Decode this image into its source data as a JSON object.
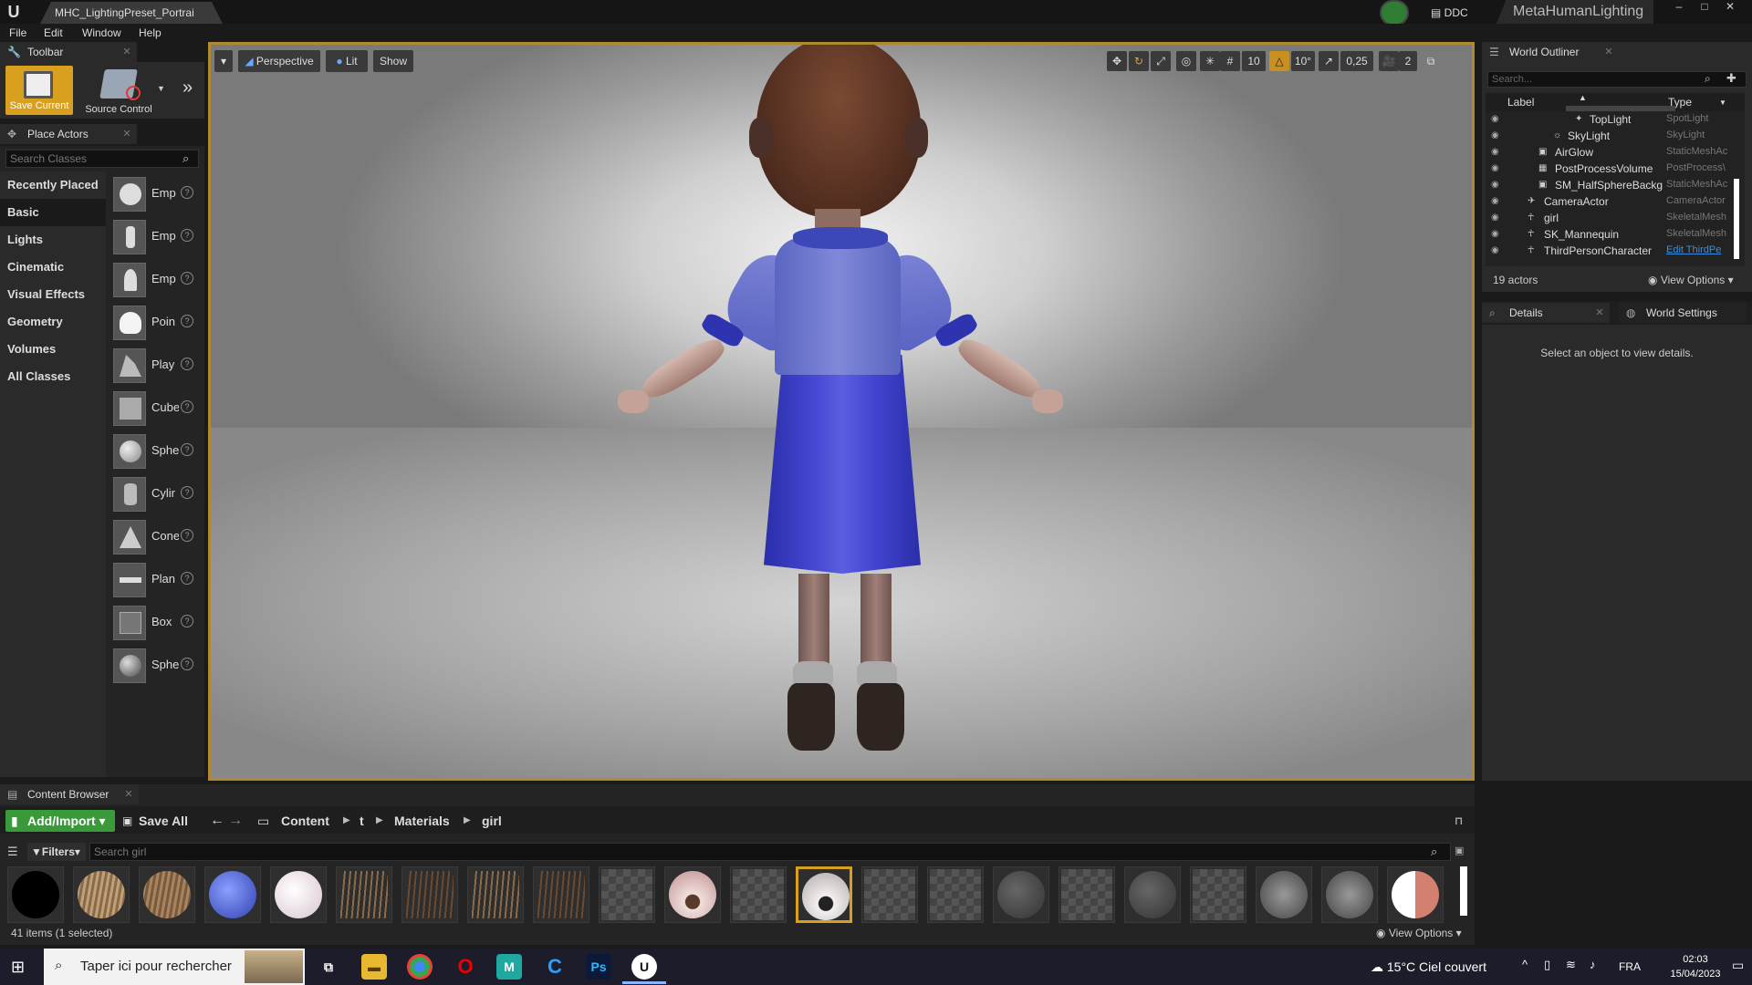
{
  "window": {
    "doc_tab": "MHC_LightingPreset_Portrai",
    "ddc": "DDC",
    "project": "MetaHumanLighting",
    "buttons": {
      "minimize": "–",
      "maximize": "□",
      "close": "✕"
    }
  },
  "menu": [
    "File",
    "Edit",
    "Window",
    "Help"
  ],
  "toolbar": {
    "tab": "Toolbar",
    "save_current": "Save Current",
    "source_control": "Source Control"
  },
  "place_actors": {
    "tab": "Place Actors",
    "search_placeholder": "Search Classes",
    "categories": [
      "Recently Placed",
      "Basic",
      "Lights",
      "Cinematic",
      "Visual Effects",
      "Geometry",
      "Volumes",
      "All Classes"
    ],
    "active_category": "Basic",
    "items": [
      {
        "label": "Emp",
        "icon": "empty-actor-icon"
      },
      {
        "label": "Emp",
        "icon": "empty-character-icon"
      },
      {
        "label": "Emp",
        "icon": "empty-pawn-icon"
      },
      {
        "label": "Poin",
        "icon": "point-light-icon"
      },
      {
        "label": "Play",
        "icon": "player-start-icon"
      },
      {
        "label": "Cube",
        "icon": "cube-icon"
      },
      {
        "label": "Sphe",
        "icon": "sphere-icon"
      },
      {
        "label": "Cylir",
        "icon": "cylinder-icon"
      },
      {
        "label": "Cone",
        "icon": "cone-icon"
      },
      {
        "label": "Plan",
        "icon": "plane-icon"
      },
      {
        "label": "Box",
        "icon": "box-trigger-icon"
      },
      {
        "label": "Sphe",
        "icon": "sphere-trigger-icon"
      }
    ]
  },
  "viewport": {
    "view_mode": "Perspective",
    "lighting": "Lit",
    "show": "Show",
    "grid_snap": "10",
    "rotation_snap": "10°",
    "scale_snap": "0,25",
    "camera_speed": "2"
  },
  "outliner": {
    "tab": "World Outliner",
    "search_placeholder": "Search...",
    "col_label": "Label",
    "col_type": "Type",
    "rows": [
      {
        "label": "TopLight",
        "type": "SpotLight",
        "indent": 3,
        "icon": "spotlight-icon"
      },
      {
        "label": "SkyLight",
        "type": "SkyLight",
        "indent": 2,
        "icon": "skylight-icon"
      },
      {
        "label": "AirGlow",
        "type": "StaticMeshAc",
        "indent": 1,
        "icon": "static-mesh-icon"
      },
      {
        "label": "PostProcessVolume",
        "type": "PostProcess\\",
        "indent": 1,
        "icon": "post-process-icon"
      },
      {
        "label": "SM_HalfSphereBackg",
        "type": "StaticMeshAc",
        "indent": 1,
        "icon": "static-mesh-icon"
      },
      {
        "label": "CameraActor",
        "type": "CameraActor",
        "indent": 0,
        "icon": "camera-icon"
      },
      {
        "label": "girl",
        "type": "SkeletalMesh",
        "indent": 0,
        "icon": "skeletal-mesh-icon"
      },
      {
        "label": "SK_Mannequin",
        "type": "SkeletalMesh",
        "indent": 0,
        "icon": "skeletal-mesh-icon"
      },
      {
        "label": "ThirdPersonCharacter",
        "type": "Edit ThirdPe",
        "indent": 0,
        "icon": "character-icon",
        "link": true
      }
    ],
    "actor_count": "19 actors",
    "view_options": "View Options"
  },
  "details": {
    "tab": "Details",
    "world_settings_tab": "World Settings",
    "empty_message": "Select an object to view details."
  },
  "content_browser": {
    "tab": "Content Browser",
    "add_import": "Add/Import",
    "save_all": "Save All",
    "breadcrumb": [
      "Content",
      "t",
      "Materials",
      "girl"
    ],
    "filters": "Filters",
    "search_placeholder": "Search girl",
    "status": "41 items (1 selected)",
    "view_options": "View Options"
  },
  "taskbar": {
    "search_placeholder": "Taper ici pour rechercher",
    "weather": "15°C  Ciel couvert",
    "lang": "FRA",
    "time": "02:03",
    "date": "15/04/2023"
  },
  "colors": {
    "accent": "#d9a020",
    "add_import_green": "#3a9a3a",
    "link_blue": "#3a8dde"
  }
}
